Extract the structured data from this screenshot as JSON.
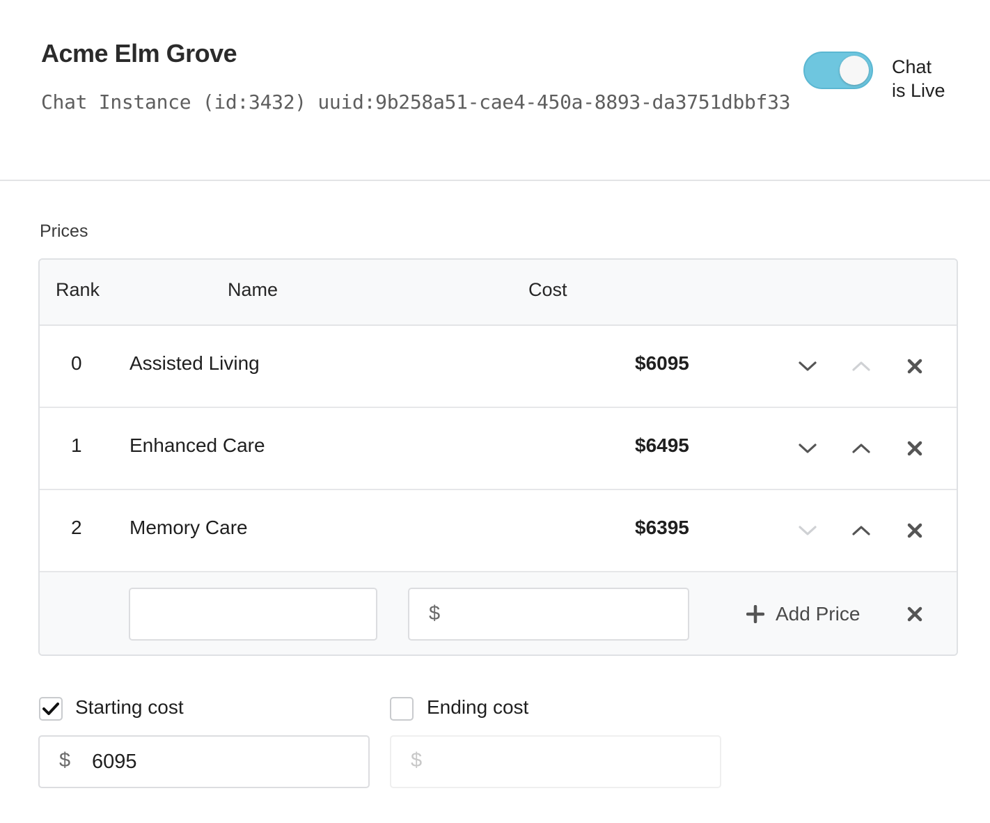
{
  "header": {
    "title": "Acme Elm Grove",
    "subtitle": "Chat Instance (id:3432) uuid:9b258a51-cae4-450a-8893-da3751dbbf33",
    "toggle_label": "Chat is Live",
    "toggle_on": true
  },
  "prices": {
    "section_label": "Prices",
    "columns": {
      "rank": "Rank",
      "name": "Name",
      "cost": "Cost"
    },
    "rows": [
      {
        "rank": "0",
        "name": "Assisted Living",
        "cost": "$6095"
      },
      {
        "rank": "1",
        "name": "Enhanced Care",
        "cost": "$6495"
      },
      {
        "rank": "2",
        "name": "Memory Care",
        "cost": "$6395"
      }
    ],
    "new_price": {
      "name_value": "",
      "cost_symbol": "$",
      "cost_value": "",
      "add_label": "Add Price"
    }
  },
  "starting_cost": {
    "label": "Starting cost",
    "checked": true,
    "symbol": "$",
    "value": "6095"
  },
  "ending_cost": {
    "label": "Ending cost",
    "checked": false,
    "symbol": "$",
    "value": ""
  },
  "colors": {
    "accent": "#6ec6df",
    "border": "#dfe1e4",
    "header_bg": "#f8f9fa"
  }
}
